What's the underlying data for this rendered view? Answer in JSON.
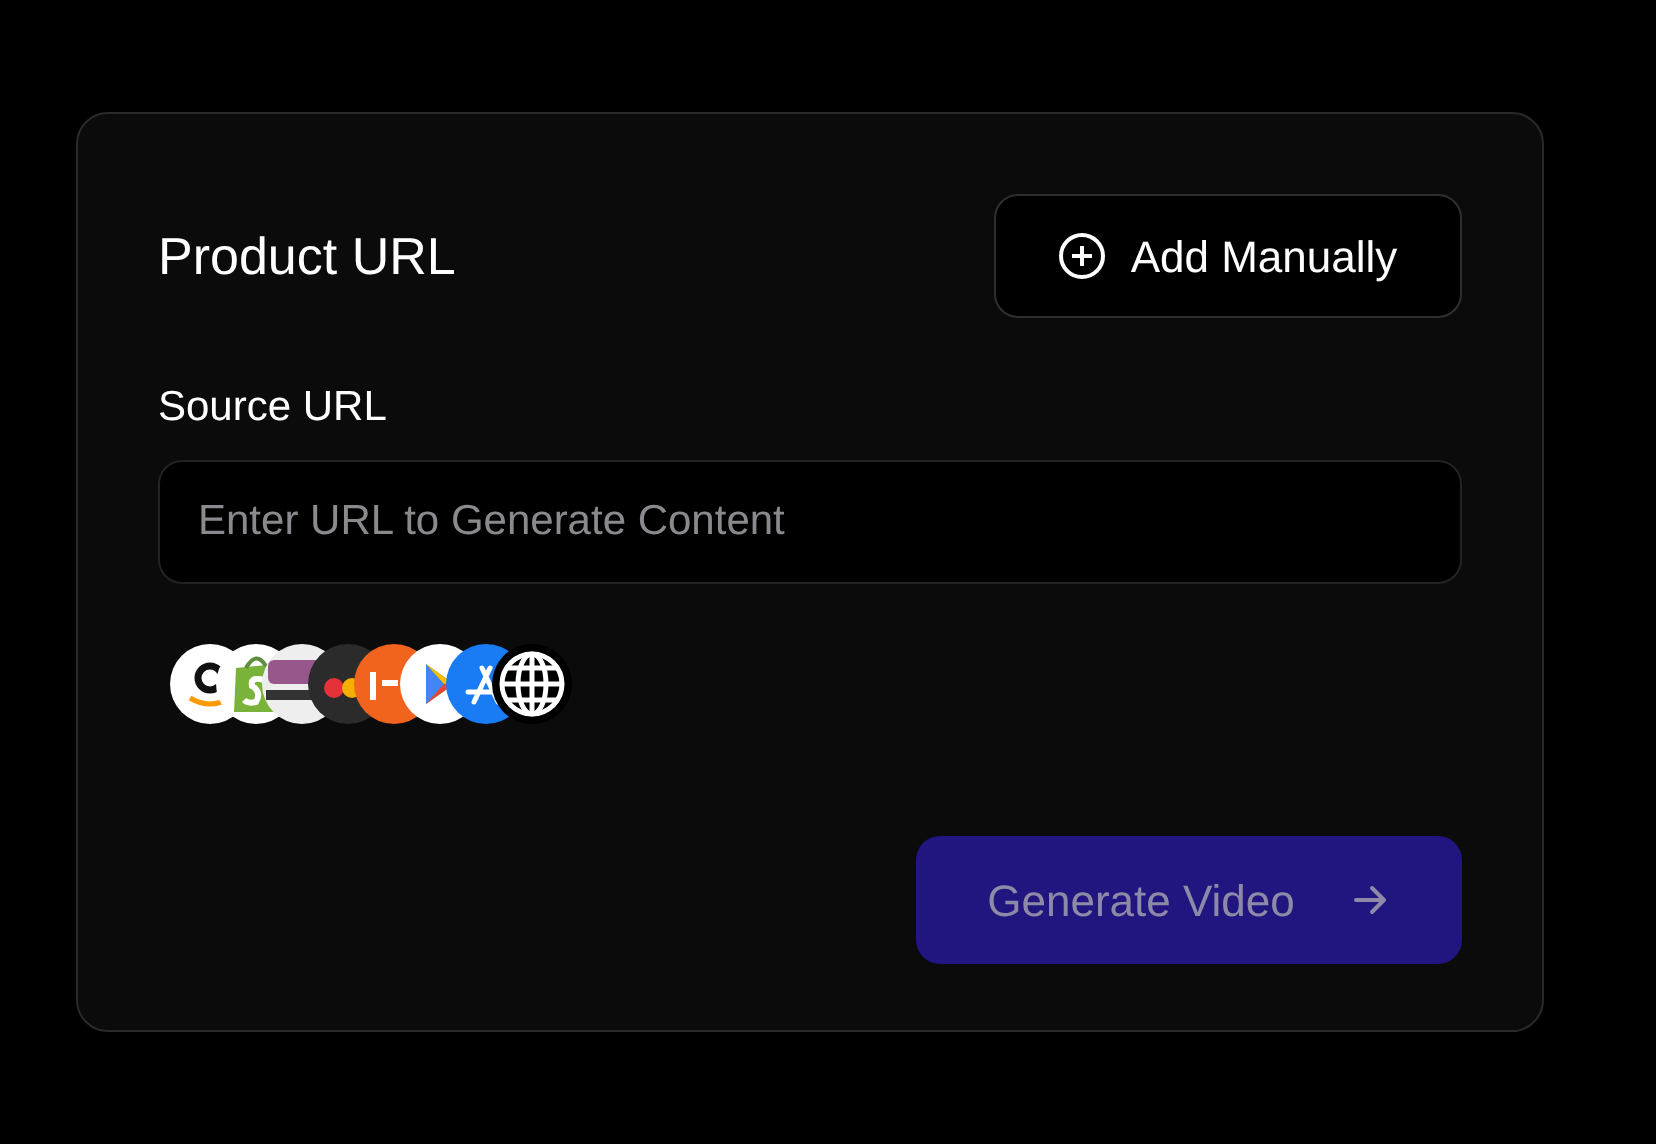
{
  "card": {
    "title": "Product URL",
    "add_button": {
      "label": "Add Manually"
    },
    "source": {
      "label": "Source URL",
      "placeholder": "Enter URL to Generate Content"
    },
    "platforms": [
      {
        "kind": "amazon"
      },
      {
        "kind": "shopify"
      },
      {
        "kind": "woocommerce"
      },
      {
        "kind": "ebay"
      },
      {
        "kind": "etsy"
      },
      {
        "kind": "playstore"
      },
      {
        "kind": "appstore"
      },
      {
        "kind": "web"
      }
    ],
    "generate_button": {
      "label": "Generate Video",
      "disabled": true
    }
  }
}
